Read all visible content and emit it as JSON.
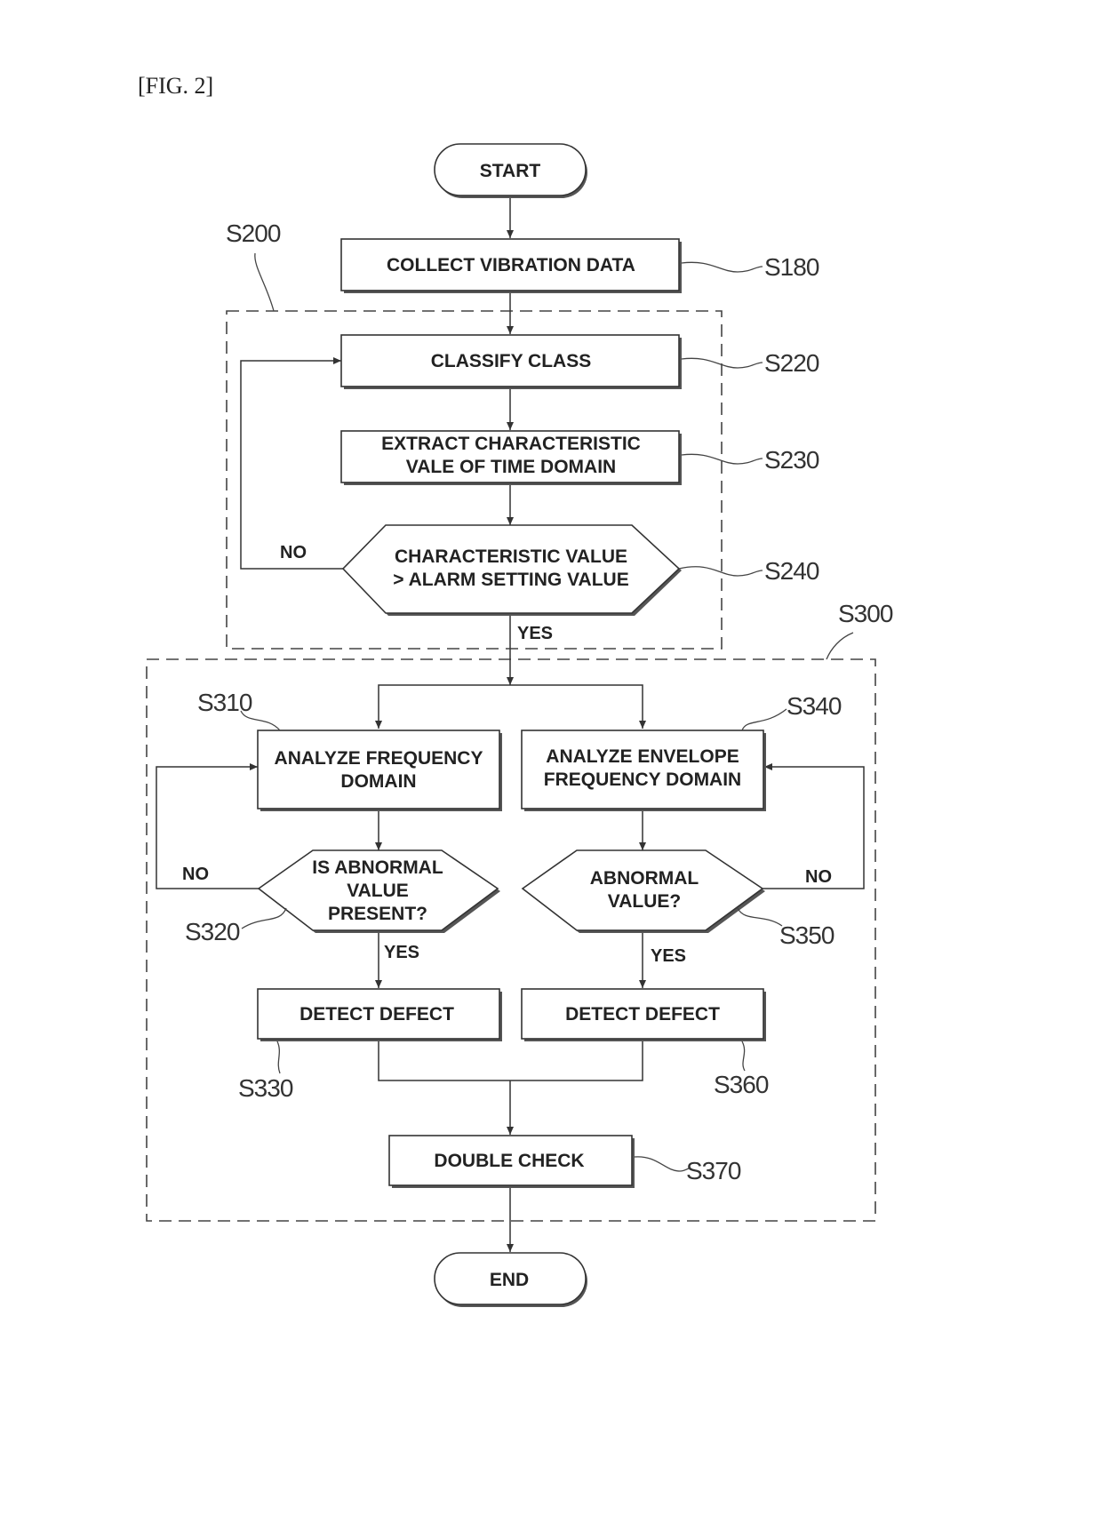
{
  "figure_label": "[FIG. 2]",
  "nodes": {
    "start": {
      "text": [
        "START"
      ],
      "type": "terminal"
    },
    "s180": {
      "text": [
        "COLLECT VIBRATION DATA"
      ],
      "type": "process",
      "ref": "S180"
    },
    "s220": {
      "text": [
        "CLASSIFY CLASS"
      ],
      "type": "process",
      "ref": "S220"
    },
    "s230": {
      "text": [
        "EXTRACT CHARACTERISTIC",
        "VALE OF TIME DOMAIN"
      ],
      "type": "process",
      "ref": "S230"
    },
    "s240": {
      "text": [
        "CHARACTERISTIC VALUE",
        "> ALARM SETTING VALUE"
      ],
      "type": "decision",
      "ref": "S240"
    },
    "s310": {
      "text": [
        "ANALYZE FREQUENCY",
        "DOMAIN"
      ],
      "type": "process",
      "ref": "S310"
    },
    "s340": {
      "text": [
        "ANALYZE ENVELOPE",
        "FREQUENCY DOMAIN"
      ],
      "type": "process",
      "ref": "S340"
    },
    "s320": {
      "text": [
        "IS ABNORMAL",
        "VALUE",
        "PRESENT?"
      ],
      "type": "decision",
      "ref": "S320"
    },
    "s350": {
      "text": [
        "ABNORMAL",
        "VALUE?"
      ],
      "type": "decision",
      "ref": "S350"
    },
    "s330": {
      "text": [
        "DETECT DEFECT"
      ],
      "type": "process",
      "ref": "S330"
    },
    "s360": {
      "text": [
        "DETECT DEFECT"
      ],
      "type": "process",
      "ref": "S360"
    },
    "s370": {
      "text": [
        "DOUBLE CHECK"
      ],
      "type": "process",
      "ref": "S370"
    },
    "end": {
      "text": [
        "END"
      ],
      "type": "terminal"
    }
  },
  "groups": {
    "s200": {
      "ref": "S200"
    },
    "s300": {
      "ref": "S300"
    }
  },
  "edge_labels": {
    "s240_no": "NO",
    "s240_yes": "YES",
    "s320_no": "NO",
    "s320_yes": "YES",
    "s350_no": "NO",
    "s350_yes": "YES"
  }
}
